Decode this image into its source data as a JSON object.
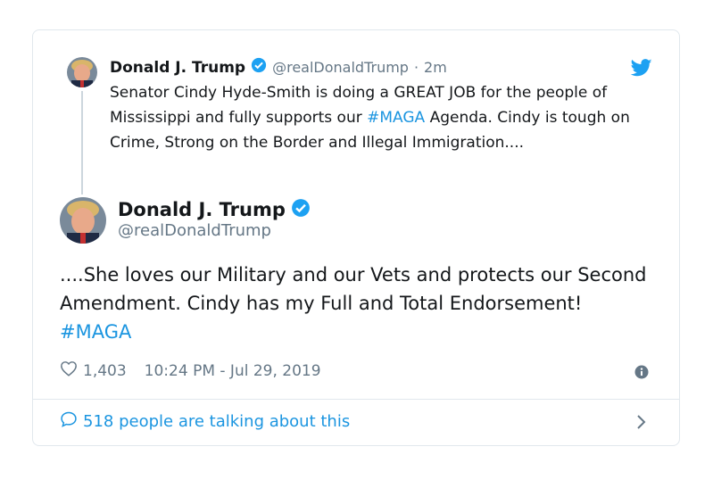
{
  "parent_tweet": {
    "display_name": "Donald J. Trump",
    "handle": "@realDonaldTrump",
    "separator": "·",
    "time_ago": "2m",
    "text_before_hashtag": "Senator Cindy Hyde-Smith is doing a GREAT JOB for the people of Mississippi and fully supports our ",
    "hashtag": "#MAGA",
    "text_after_hashtag": " Agenda. Cindy is tough on Crime, Strong on the Border and Illegal Immigration...."
  },
  "main_tweet": {
    "display_name": "Donald J. Trump",
    "handle": "@realDonaldTrump",
    "text_before_hashtag": "....She loves our Military and our Vets and protects our Second Amendment. Cindy has my Full and Total Endorsement! ",
    "hashtag": "#MAGA"
  },
  "meta": {
    "like_count": "1,403",
    "timestamp": "10:24 PM - Jul 29, 2019"
  },
  "footer": {
    "talking_text": "518 people are talking about this"
  },
  "icons": {
    "verified": "verified-badge-icon",
    "bird": "twitter-bird-icon",
    "heart": "heart-icon",
    "info": "info-icon",
    "comment": "comment-bubble-icon",
    "chevron": "chevron-right-icon"
  },
  "colors": {
    "accent": "#1b95e0",
    "muted": "#657786",
    "border": "#e1e8ed"
  }
}
